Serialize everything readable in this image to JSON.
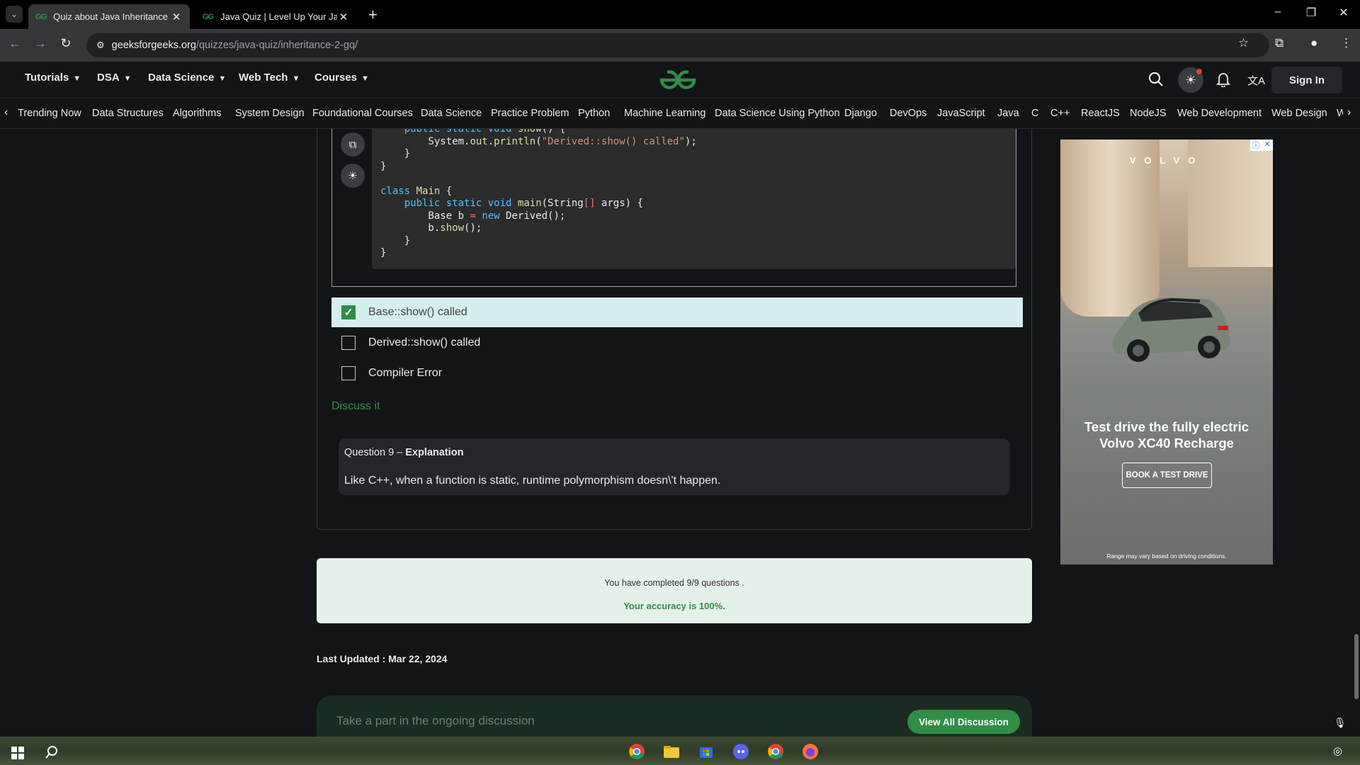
{
  "browser": {
    "tabs": [
      {
        "title": "Quiz about Java Inheritance",
        "favicon": "gfg-icon",
        "active": true
      },
      {
        "title": "Java Quiz | Level Up Your Java S",
        "favicon": "gfg-icon",
        "active": false
      }
    ],
    "url_host": "geeksforgeeks.org",
    "url_path": "/quizzes/java-quiz/inheritance-2-gq/"
  },
  "header": {
    "menu": [
      {
        "label": "Tutorials"
      },
      {
        "label": "DSA"
      },
      {
        "label": "Data Science"
      },
      {
        "label": "Web Tech"
      },
      {
        "label": "Courses"
      }
    ],
    "sign_in": "Sign In"
  },
  "subnav": {
    "items": [
      "Trending Now",
      "Data Structures",
      "Algorithms",
      "System Design",
      "Foundational Courses",
      "Data Science",
      "Practice Problem",
      "Python",
      "Machine Learning",
      "Data Science Using Python",
      "Django",
      "DevOps",
      "JavaScript",
      "Java",
      "C",
      "C++",
      "ReactJS",
      "NodeJS",
      "Web Development",
      "Web Design",
      "W"
    ]
  },
  "question": {
    "options": [
      {
        "label": "Base::show() called",
        "checked": true
      },
      {
        "label": "Derived::show() called",
        "checked": false
      },
      {
        "label": "Compiler Error",
        "checked": false
      }
    ],
    "discuss_link": "Discuss it",
    "explanation": {
      "heading_prefix": "Question 9 – ",
      "heading_bold": "Explanation",
      "text": "Like C++, when a function is static, runtime polymorphism doesn\\'t happen."
    }
  },
  "result": {
    "completed": "You have completed 9/9 questions .",
    "accuracy": "Your accuracy is 100%."
  },
  "last_updated": "Last Updated : Mar 22, 2024",
  "discussion": {
    "placeholder": "Take a part in the ongoing discussion",
    "button": "View All Discussion"
  },
  "ad": {
    "brand": "VOLVO",
    "headline_line1": "Test drive the fully electric",
    "headline_line2": "Volvo XC40 Recharge",
    "cta": "BOOK A TEST DRIVE",
    "fine_print": "Range may vary based on driving conditions."
  },
  "colors": {
    "accent": "#2f8d46",
    "page_bg": "#131417",
    "selected_option_bg": "#d5eeee",
    "result_bg": "#e4f1e8"
  }
}
